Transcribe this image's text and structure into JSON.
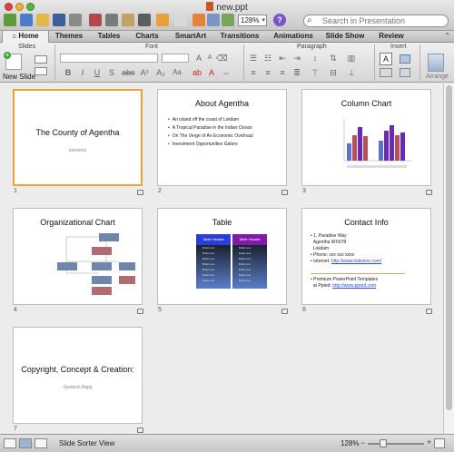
{
  "window": {
    "title": "new.ppt"
  },
  "toolbar": {
    "zoom": "128%",
    "search_placeholder": "Search in Presentation",
    "help_glyph": "?"
  },
  "tabs": [
    "Home",
    "Themes",
    "Tables",
    "Charts",
    "SmartArt",
    "Transitions",
    "Animations",
    "Slide Show",
    "Review"
  ],
  "ribbon": {
    "groups": [
      "Slides",
      "Font",
      "Paragraph",
      "Insert"
    ],
    "new_slide": "New Slide",
    "arrange": "Arrange",
    "bold": "B",
    "italic": "I",
    "underline": "U",
    "font_color": "A",
    "aa": "Aa"
  },
  "slides": [
    {
      "number": "1",
      "title": "The County of Agentha",
      "subtitle": "presents"
    },
    {
      "number": "2",
      "title": "About Agentha",
      "bullets": [
        "An island off the coast of Lokilam",
        "A Tropical Paradise in the Indian Ocean",
        "On The Verge of An Economic Overhaul",
        "Investment Opportunities Galore"
      ]
    },
    {
      "number": "3",
      "title": "Column Chart"
    },
    {
      "number": "4",
      "title": "Organizational Chart"
    },
    {
      "number": "5",
      "title": "Table",
      "col1_header": "Table Header",
      "col2_header": "Table Header",
      "cell_text": "Bullet text"
    },
    {
      "number": "6",
      "title": "Contact Info",
      "address": [
        "1, Paradise Way",
        "Agentha WX678",
        "Lokilam"
      ],
      "phone": "Phone: xxx xxx xxxx",
      "internet_label": "Internet: ",
      "internet_link": "http://www.indezine.com/",
      "templates": [
        "Premium PowerPoint Templates",
        "at Ppted: "
      ],
      "templates_link": "http://www.ppted.com"
    },
    {
      "number": "7",
      "title": "Copyright, Concept & Creation:",
      "subtitle": "Geetesh Bajaj"
    }
  ],
  "status": {
    "view": "Slide Sorter View",
    "zoom": "128%"
  },
  "colors": {
    "selection": "#f0a035",
    "bar_blue": "#5b74c9",
    "bar_purple": "#6a2ab3",
    "bar_red": "#b8505b",
    "table_blue": "#2c3fd4",
    "table_purple": "#7f1ca6",
    "org_top": "#6e86a8",
    "org_mid": "#b06b73"
  }
}
